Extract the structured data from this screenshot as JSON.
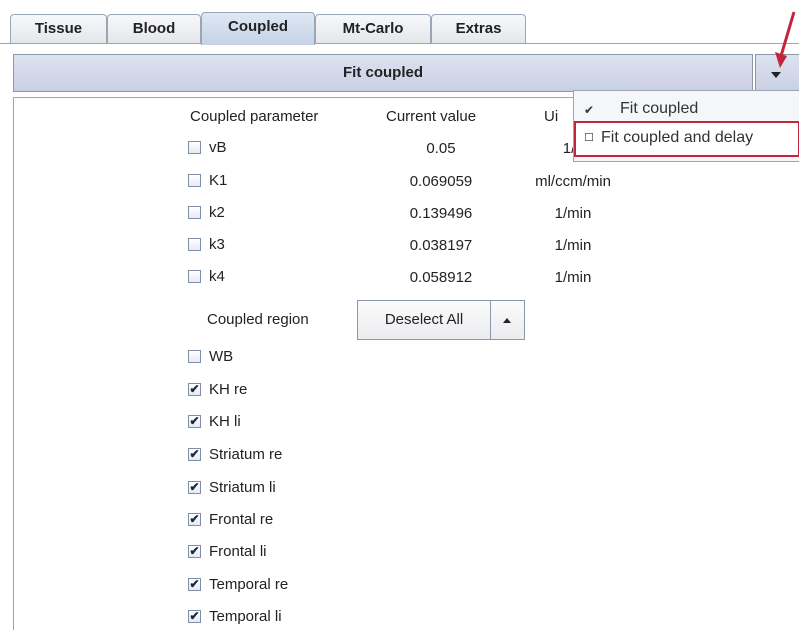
{
  "tabs": [
    "Tissue",
    "Blood",
    "Coupled",
    "Mt-Carlo",
    "Extras"
  ],
  "active_tab": "Coupled",
  "fit_mode": {
    "selected": "Fit coupled"
  },
  "fit_menu": {
    "items": [
      {
        "label": "Fit coupled",
        "checked": true
      },
      {
        "label": "Fit coupled and delay",
        "checked": false,
        "highlighted": true
      }
    ]
  },
  "headers": {
    "parameter": "Coupled parameter",
    "value": "Current value",
    "unit": "Ui"
  },
  "parameters": [
    {
      "name": "vB",
      "value": "0.05",
      "unit": "1/",
      "checked": false
    },
    {
      "name": "K1",
      "value": "0.069059",
      "unit": "ml/ccm/min",
      "checked": false
    },
    {
      "name": "k2",
      "value": "0.139496",
      "unit": "1/min",
      "checked": false
    },
    {
      "name": "k3",
      "value": "0.038197",
      "unit": "1/min",
      "checked": false
    },
    {
      "name": "k4",
      "value": "0.058912",
      "unit": "1/min",
      "checked": false
    }
  ],
  "region": {
    "label": "Coupled region",
    "deselect_label": "Deselect All"
  },
  "regions": [
    {
      "name": "WB",
      "checked": false
    },
    {
      "name": "KH re",
      "checked": true
    },
    {
      "name": "KH li",
      "checked": true
    },
    {
      "name": "Striatum re",
      "checked": true
    },
    {
      "name": "Striatum li",
      "checked": true
    },
    {
      "name": "Frontal re",
      "checked": true
    },
    {
      "name": "Frontal li",
      "checked": true
    },
    {
      "name": "Temporal re",
      "checked": true
    },
    {
      "name": "Temporal li",
      "checked": true
    }
  ],
  "colors": {
    "annotation_red": "#c0273a",
    "active_tab": "#c4d3e6",
    "fit_bar": "#c9d0e3"
  },
  "icons": {
    "check": "✔",
    "dropdown": "triangle-down",
    "collapse": "triangle-up"
  }
}
